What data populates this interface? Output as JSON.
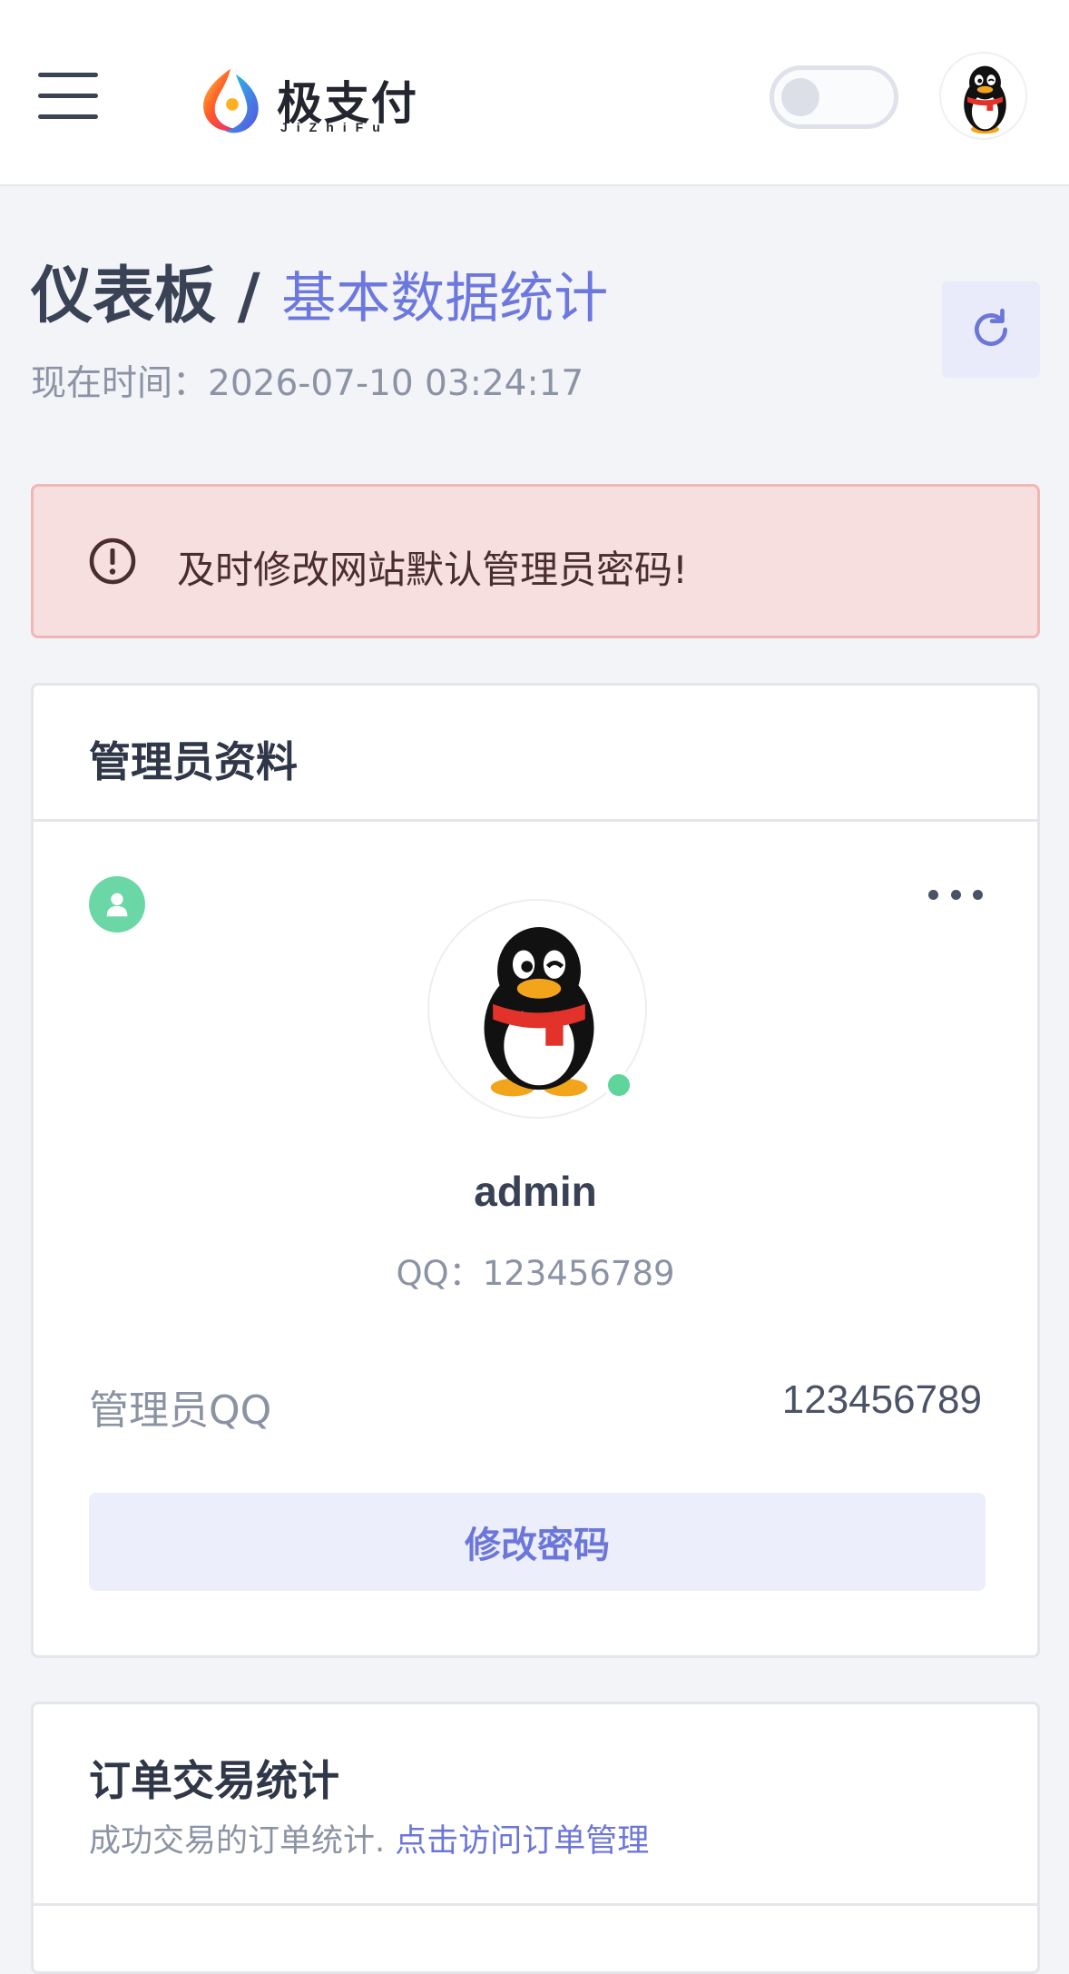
{
  "header": {
    "logo_name": "极支付",
    "logo_sub": "JiZhiFu",
    "menu_icon": "hamburger-menu-icon",
    "theme_toggle_icon": "toggle-switch-icon",
    "avatar_icon": "qq-penguin-avatar-icon"
  },
  "page": {
    "title": "仪表板",
    "separator": " / ",
    "subtitle": "基本数据统计",
    "time_label": "现在时间：",
    "time_value": "2026-07-10 03:24:17",
    "refresh_icon": "refresh-icon"
  },
  "alert": {
    "icon": "exclamation-circle-icon",
    "text": "及时修改网站默认管理员密码!"
  },
  "admin_card": {
    "title": "管理员资料",
    "badge_icon": "user-icon",
    "more_icon": "more-dots-icon",
    "username": "admin",
    "qq_label": "QQ：",
    "qq_value": "123456789",
    "info_label": "管理员QQ",
    "info_value": "123456789",
    "button_label": "修改密码"
  },
  "orders_card": {
    "title": "订单交易统计",
    "desc": "成功交易的订单统计.",
    "link": "点击访问订单管理"
  },
  "colors": {
    "accent": "#6c76d9",
    "alert_bg": "#f6dfde",
    "online": "#5fd59c",
    "badge": "#6bd7a6"
  }
}
